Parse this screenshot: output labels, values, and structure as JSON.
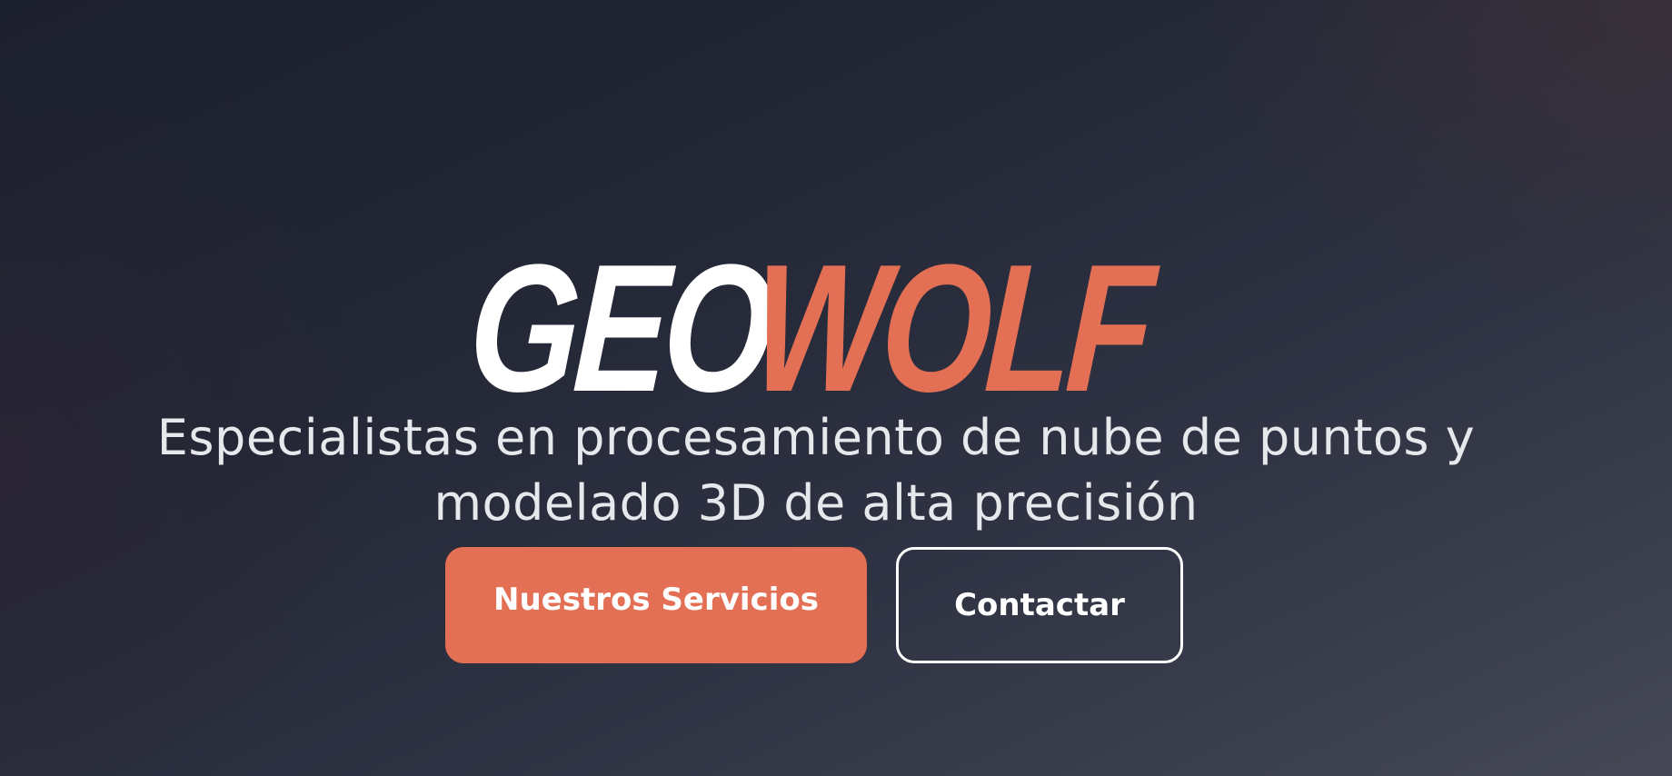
{
  "hero": {
    "logo": {
      "part1": "GEO",
      "part2": "WOLF"
    },
    "tagline": {
      "line1": "Especialistas en procesamiento de nube de puntos y",
      "line2": "modelado 3D de alta precisión"
    },
    "buttons": {
      "primary_label": "Nuestros Servicios",
      "secondary_label": "Contactar"
    }
  },
  "colors": {
    "accent": "#e37055",
    "background_dark": "#1d202d",
    "background_light": "#454854",
    "text": "#ffffff",
    "tagline_text": "#e7e8ec"
  }
}
